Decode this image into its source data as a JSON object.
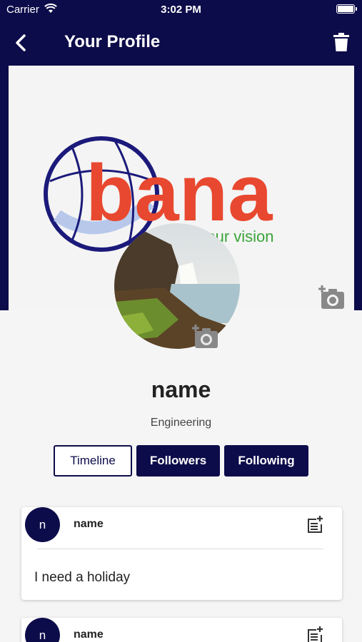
{
  "status_bar": {
    "carrier": "Carrier",
    "time": "3:02 PM"
  },
  "nav": {
    "title": "Your Profile",
    "back_icon": "chevron-left-icon",
    "delete_icon": "trash-icon"
  },
  "cover": {
    "logo_text": "bana",
    "logo_tagline": "h your vision",
    "camera_icon": "add-photo-icon"
  },
  "profile": {
    "name": "name",
    "department": "Engineering",
    "camera_icon": "add-photo-icon"
  },
  "tabs": [
    {
      "label": "Timeline",
      "active": true
    },
    {
      "label": "Followers",
      "active": false
    },
    {
      "label": "Following",
      "active": false
    }
  ],
  "posts": [
    {
      "initial": "n",
      "author": "name",
      "text": "I need a holiday",
      "edit_icon": "post-add-icon"
    },
    {
      "initial": "n",
      "author": "name",
      "text": "",
      "edit_icon": "post-add-icon"
    }
  ],
  "colors": {
    "primary": "#0d0c4a",
    "logo_orange": "#e8482f",
    "logo_green": "#3aa43a"
  }
}
